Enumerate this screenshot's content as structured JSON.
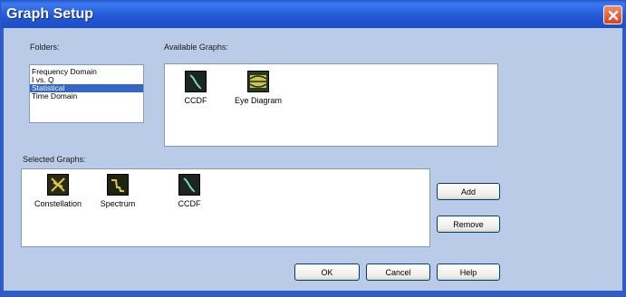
{
  "window": {
    "title": "Graph Setup",
    "close_icon": "close-icon"
  },
  "folders": {
    "label": "Folders:",
    "items": [
      {
        "label": "Frequency Domain",
        "selected": false
      },
      {
        "label": "I vs. Q",
        "selected": false
      },
      {
        "label": "Statistical",
        "selected": true
      },
      {
        "label": "Time Domain",
        "selected": false
      }
    ]
  },
  "available": {
    "label": "Available Graphs:",
    "graphs": [
      {
        "label": "CCDF",
        "icon": "ccdf-graph-icon"
      },
      {
        "label": "Eye Diagram",
        "icon": "eye-diagram-graph-icon"
      }
    ]
  },
  "selected_graphs": {
    "label": "Selected Graphs:",
    "graphs": [
      {
        "label": "Constellation",
        "icon": "constellation-graph-icon"
      },
      {
        "label": "Spectrum",
        "icon": "spectrum-graph-icon"
      },
      {
        "label": "CCDF",
        "icon": "ccdf-graph-icon"
      }
    ]
  },
  "buttons": {
    "add": "Add",
    "remove": "Remove",
    "ok": "OK",
    "cancel": "Cancel",
    "help": "Help"
  },
  "colors": {
    "title_bar": "#2459d6",
    "dialog_bg": "#b9cbe6",
    "selection": "#3267c8",
    "close_button": "#d8431f",
    "graph_trace": "#4fd07a"
  }
}
